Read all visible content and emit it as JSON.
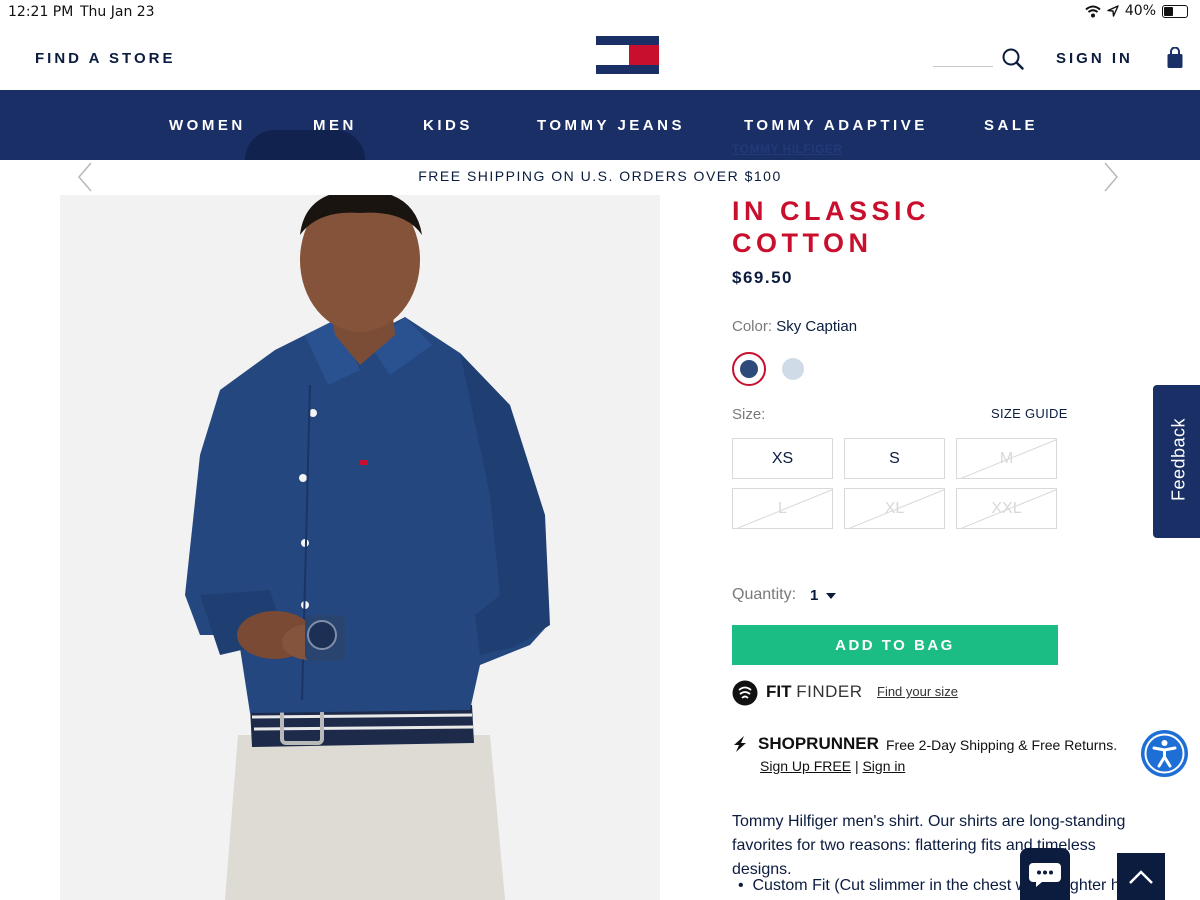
{
  "status_bar": {
    "time": "12:21 PM",
    "date": "Thu Jan 23",
    "battery": "40%",
    "battery_level": 0.4
  },
  "header": {
    "find_store": "FIND A STORE",
    "sign_in": "SIGN IN"
  },
  "nav": {
    "items": [
      "WOMEN",
      "MEN",
      "KIDS",
      "TOMMY JEANS",
      "TOMMY ADAPTIVE",
      "SALE"
    ]
  },
  "banner": {
    "text": "FREE SHIPPING ON U.S. ORDERS OVER $100"
  },
  "product": {
    "brand": "TOMMY HILFIGER",
    "title_lines": [
      "IN CLASSIC",
      "COTTON"
    ],
    "price": "$69.50",
    "color_label": "Color:",
    "color_value": "Sky Captian",
    "colors": {
      "selected": "#2e4a7b",
      "alternate": "#cfdbe6",
      "accent_red": "#c8102e",
      "navy": "#1a2f65",
      "green": "#1cbd84"
    },
    "size_label": "Size:",
    "size_guide": "SIZE GUIDE",
    "sizes": [
      {
        "label": "XS",
        "available": true
      },
      {
        "label": "S",
        "available": true
      },
      {
        "label": "M",
        "available": false
      },
      {
        "label": "L",
        "available": false
      },
      {
        "label": "XL",
        "available": false
      },
      {
        "label": "XXL",
        "available": false
      }
    ],
    "quantity_label": "Quantity:",
    "quantity_value": "1",
    "add_to_bag": "ADD TO BAG",
    "fit_finder": {
      "fit": "FIT",
      "finder": "FINDER",
      "link": "Find your size"
    },
    "shoprunner": {
      "brand": "SHOPRUNNER",
      "text": "Free 2-Day Shipping & Free Returns.",
      "signup": "Sign Up FREE",
      "separator": "|",
      "signin": "Sign in"
    },
    "description": "Tommy Hilfiger men's shirt. Our shirts are long-standing favorites for two reasons: flattering fits and timeless designs.",
    "bullet": "Custom Fit (Cut slimmer in the chest with a tighter hem"
  },
  "widgets": {
    "feedback": "Feedback"
  }
}
